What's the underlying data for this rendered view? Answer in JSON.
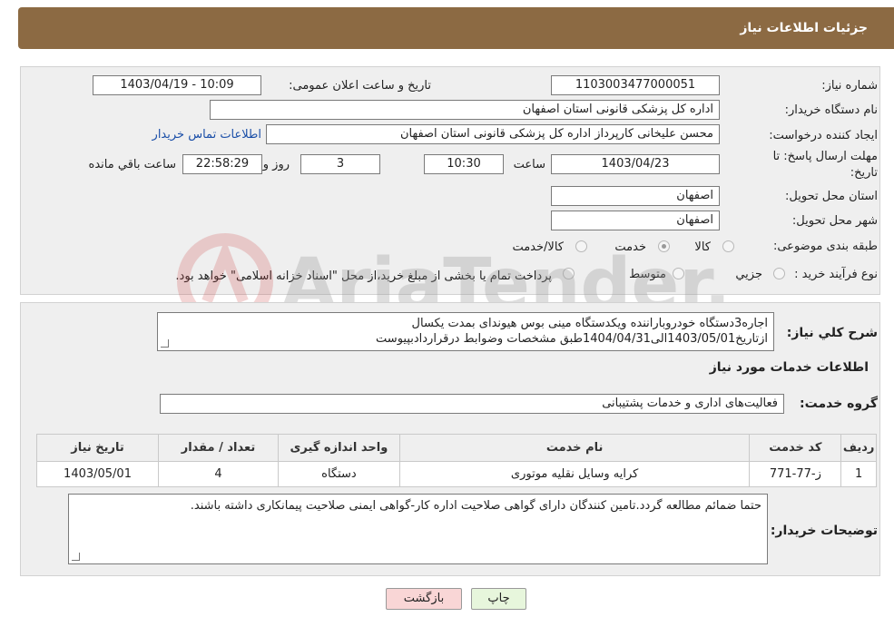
{
  "header": {
    "title": "جزئیات اطلاعات نیاز"
  },
  "fields": {
    "need_number_label": "شماره نیاز:",
    "need_number": "1103003477000051",
    "announce_label": "تاریخ و ساعت اعلان عمومی:",
    "announce_value": "1403/04/19 - 10:09",
    "buyer_org_label": "نام دستگاه خریدار:",
    "buyer_org": "اداره کل پزشکی قانونی استان اصفهان",
    "creator_label": "ایجاد کننده درخواست:",
    "creator": "محسن علیخانی کارپرداز اداره کل پزشکی قانونی استان اصفهان",
    "contact_link": "اطلاعات تماس خریدار",
    "deadline_label": "مهلت ارسال پاسخ: تا",
    "deadline_label2": "تاریخ:",
    "deadline_date": "1403/04/23",
    "time_label": "ساعت",
    "deadline_time": "10:30",
    "days_value": "3",
    "days_label": "روز و",
    "remaining_value": "22:58:29",
    "remaining_label": "ساعت باقي مانده",
    "province_label": "استان محل تحویل:",
    "province": "اصفهان",
    "city_label": "شهر محل تحویل:",
    "city": "اصفهان",
    "category_label": "طبقه بندی موضوعی:",
    "category_options": [
      "کالا",
      "خدمت",
      "کالا/خدمت"
    ],
    "category_selected": "خدمت",
    "process_label": "نوع فرآیند خرید :",
    "process_options": [
      "جزيي",
      "متوسط"
    ],
    "process_note": "پرداخت تمام یا بخشی از مبلغ خرید،از محل \"اسناد خزانه اسلامی\" خواهد بود.",
    "description_label": "شرح کلي نياز:",
    "description_line1": "اجاره3دستگاه خودروباراننده ویکدستگاه مینی بوس هیوندای بمدت یکسال",
    "description_line2": "ازتاریخ1403/05/01الی1404/04/31طبق مشخصات وضوابط درقراردادبپیوست"
  },
  "services": {
    "section_title": "اطلاعات خدمات مورد نیاز",
    "group_label": "گروه خدمت:",
    "group_value": "فعالیت‌های اداری و خدمات پشتیبانی",
    "columns": [
      "ردیف",
      "کد خدمت",
      "نام خدمت",
      "واحد اندازه گیری",
      "تعداد / مقدار",
      "تاریخ نیاز"
    ],
    "rows": [
      [
        "1",
        "ز-77-771",
        "کرایه وسایل نقلیه موتوری",
        "دستگاه",
        "4",
        "1403/05/01"
      ]
    ]
  },
  "buyer_notes": {
    "label": "توضیحات خریدار:",
    "text": "حتما ضمائم مطالعه گردد.تامین کنندگان دارای گواهی صلاحیت اداره کار-گواهی ایمنی صلاحیت پیمانکاری داشته باشند."
  },
  "buttons": {
    "print": "چاپ",
    "back": "بازگشت"
  },
  "watermark": {
    "text": "AriaTender.neT"
  },
  "colors": {
    "header": "#8c6a43",
    "panel": "#efefef",
    "link": "#1b4fa8",
    "back_button": "#f9d6d6",
    "print_button": "#e7f6dc"
  }
}
